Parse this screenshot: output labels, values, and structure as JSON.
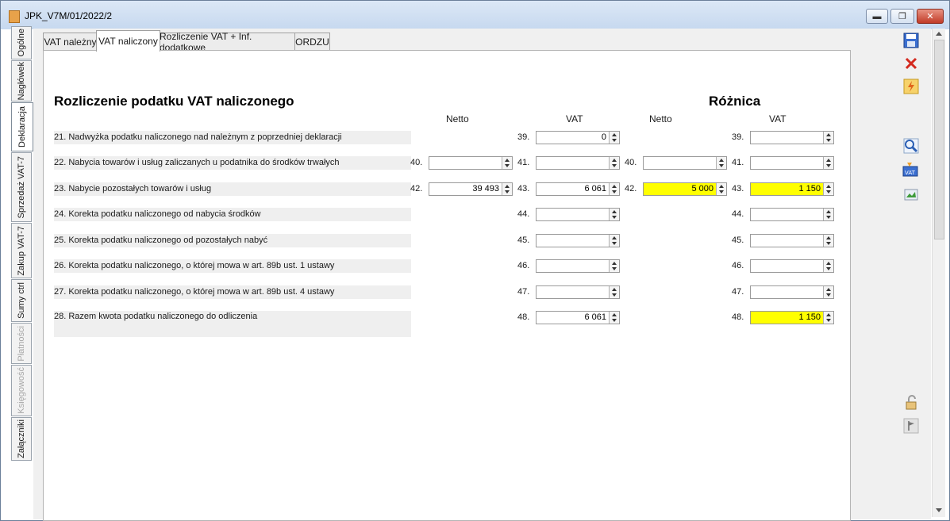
{
  "window": {
    "title": "JPK_V7M/01/2022/2"
  },
  "side_tabs": [
    {
      "label": "Ogólne"
    },
    {
      "label": "Nagłówek"
    },
    {
      "label": "Deklaracja"
    },
    {
      "label": "Sprzedaż VAT-7"
    },
    {
      "label": "Zakup VAT-7"
    },
    {
      "label": "Sumy ctrl"
    },
    {
      "label": "Płatności"
    },
    {
      "label": "Księgowość"
    },
    {
      "label": "Załączniki"
    }
  ],
  "tabs": [
    {
      "label": "VAT należny"
    },
    {
      "label": "VAT naliczony"
    },
    {
      "label": "Rozliczenie VAT + Inf. dodatkowe"
    },
    {
      "label": "ORDZU"
    }
  ],
  "section": {
    "title": "Rozliczenie podatku VAT naliczonego",
    "diff_title": "Różnica",
    "col_netto": "Netto",
    "col_vat": "VAT",
    "col_diff_netto": "Netto",
    "col_diff_vat": "VAT"
  },
  "rows": [
    {
      "label": "21. Nadwyżka podatku naliczonego nad należnym z poprzedniej deklaracji",
      "vat_no": "39.",
      "vat": "0",
      "diff_vat_no": "39.",
      "diff_vat": ""
    },
    {
      "label": "22. Nabycia towarów i usług zaliczanych u podatnika do środków trwałych",
      "netto_no": "40.",
      "netto": "",
      "vat_no": "41.",
      "vat": "",
      "diff_netto_no": "40.",
      "diff_netto": "",
      "diff_vat_no": "41.",
      "diff_vat": ""
    },
    {
      "label": "23. Nabycie pozostałych towarów i usług",
      "netto_no": "42.",
      "netto": "39 493",
      "vat_no": "43.",
      "vat": "6 061",
      "diff_netto_no": "42.",
      "diff_netto": "5 000",
      "diff_vat_no": "43.",
      "diff_vat": "1 150"
    },
    {
      "label": "24.  Korekta podatku naliczonego od nabycia środków",
      "vat_no": "44.",
      "vat": "",
      "diff_vat_no": "44.",
      "diff_vat": ""
    },
    {
      "label": "25. Korekta podatku naliczonego od pozostałych nabyć",
      "vat_no": "45.",
      "vat": "",
      "diff_vat_no": "45.",
      "diff_vat": ""
    },
    {
      "label": "26. Korekta podatku naliczonego, o której mowa w art. 89b ust. 1 ustawy",
      "vat_no": "46.",
      "vat": "",
      "diff_vat_no": "46.",
      "diff_vat": ""
    },
    {
      "label": "27. Korekta podatku naliczonego, o której mowa w art. 89b ust. 4 ustawy",
      "vat_no": "47.",
      "vat": "",
      "diff_vat_no": "47.",
      "diff_vat": ""
    },
    {
      "label": "28.  Razem kwota podatku naliczonego do odliczenia",
      "vat_no": "48.",
      "vat": "6 061",
      "diff_vat_no": "48.",
      "diff_vat": "1 150"
    }
  ],
  "colors": {
    "highlight": "#ffff00",
    "accent": "#2b5fb4"
  },
  "toolbar_icons": [
    "save-icon",
    "cancel-icon",
    "lightning-icon",
    "preview-icon",
    "vat-icon",
    "export-icon",
    "unlock-icon",
    "flag-icon"
  ]
}
